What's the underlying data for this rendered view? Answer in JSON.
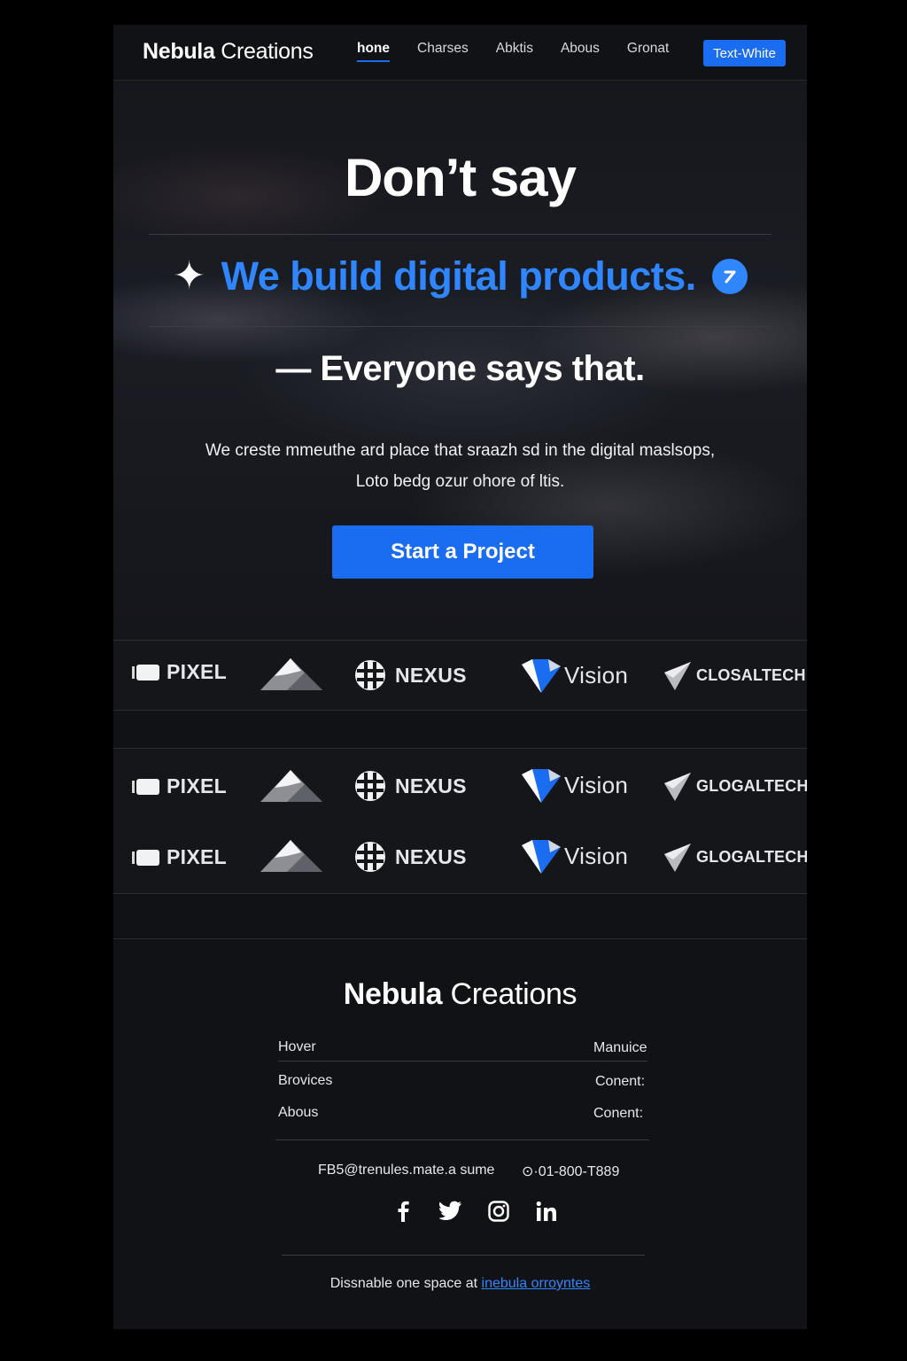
{
  "nav": {
    "brand_bold": "Nebula",
    "brand_light": "Creations",
    "links": [
      "hone",
      "Charses",
      "Abktis",
      "Abous",
      "Gronat"
    ],
    "cta": "Text-White"
  },
  "hero": {
    "title": "Don’t say",
    "tagline": "We build digital products.",
    "subtitle": "— Everyone says that.",
    "description_line1": "We creste mmeuthe ard place that sraazh sd in the digital maslsops,",
    "description_line2": "Loto bedg ozur ohore of ltis.",
    "cta": "Start a Project"
  },
  "logo_rows": [
    {
      "pixel": "PIXEL",
      "nexus": "NEXUS",
      "vision": "Vision",
      "global": "CLOSALTECH"
    },
    {
      "pixel": "PIXEL",
      "nexus": "NEXUS",
      "vision": "Vision",
      "global": "GLOGALTECH"
    },
    {
      "pixel": "PIXEL",
      "nexus": "NEXUS",
      "vision": "Vision",
      "global": "GLOGALTECH"
    }
  ],
  "footer": {
    "brand_bold": "Nebula",
    "brand_light": "Creations",
    "left_links": [
      "Hover",
      "Brovices",
      "Abous"
    ],
    "right_links": [
      "Manuice",
      "Conent:",
      "Conent:"
    ],
    "email": "FB5@trenules.mate.a sume",
    "phone": "⊙·01-800-T889",
    "note_prefix": "Dissnable one space at",
    "note_link": "inebula orroyntes"
  },
  "colors": {
    "accent": "#1a6cf0",
    "tagline": "#2f86ff",
    "page_bg": "#111216",
    "outer_bg": "#000000"
  },
  "icons": {
    "tagline_left": "sparkle-icon",
    "tagline_right": "check-badge-icon",
    "socials": [
      "facebook-icon",
      "twitter-icon",
      "instagram-icon",
      "linkedin-icon"
    ]
  }
}
